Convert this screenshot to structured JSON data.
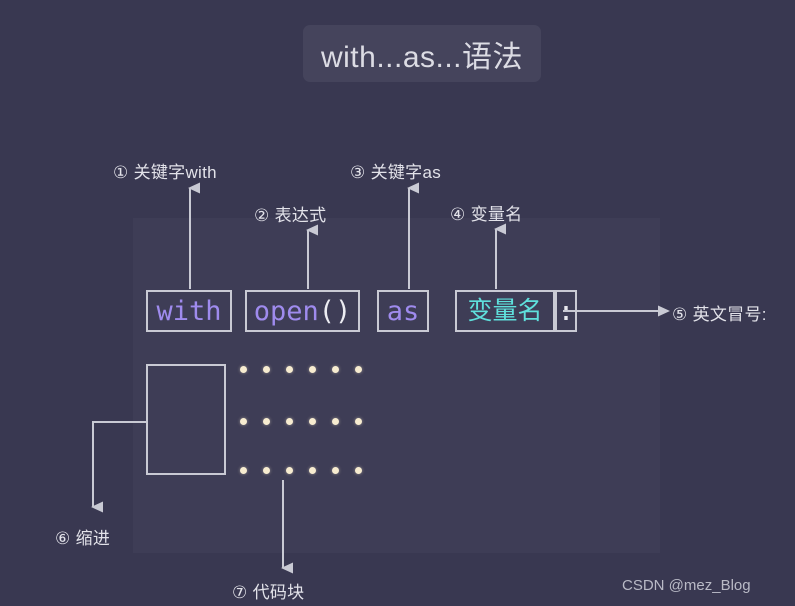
{
  "page": {
    "background_color": "#393851",
    "panel_color": "#3e3d56",
    "title_chip_color": "#45445c",
    "line_color": "#c9cad4",
    "keyword_color": "#9f8bee",
    "variable_color": "#5fe0dc",
    "punctuation_color": "#e8e8ee",
    "dot_color": "#f7ecd0",
    "text_color": "#e2e2e9"
  },
  "title": "with...as...语法",
  "code": {
    "tokens": [
      {
        "id": "with",
        "text": "with",
        "role": "keyword"
      },
      {
        "id": "open",
        "text": "open",
        "suffix": "()",
        "role": "expression"
      },
      {
        "id": "as",
        "text": "as",
        "role": "keyword"
      },
      {
        "id": "var",
        "text": "变量名",
        "role": "variable"
      },
      {
        "id": "colon",
        "text": ":",
        "role": "punctuation"
      }
    ],
    "indent_box_label": "",
    "dot_rows": 3,
    "dots_per_row": 6
  },
  "annotations": [
    {
      "num": "①",
      "label": "① 关键字with",
      "target": "with"
    },
    {
      "num": "②",
      "label": "② 表达式",
      "target": "open()"
    },
    {
      "num": "③",
      "label": "③ 关键字as",
      "target": "as"
    },
    {
      "num": "④",
      "label": "④ 变量名",
      "target": "变量名"
    },
    {
      "num": "⑤",
      "label": "⑤ 英文冒号:",
      "target": ":"
    },
    {
      "num": "⑥",
      "label": "⑥ 缩进",
      "target": "indent-box"
    },
    {
      "num": "⑦",
      "label": "⑦ 代码块",
      "target": "code-block-dots"
    }
  ],
  "watermark": "CSDN @mez_Blog"
}
